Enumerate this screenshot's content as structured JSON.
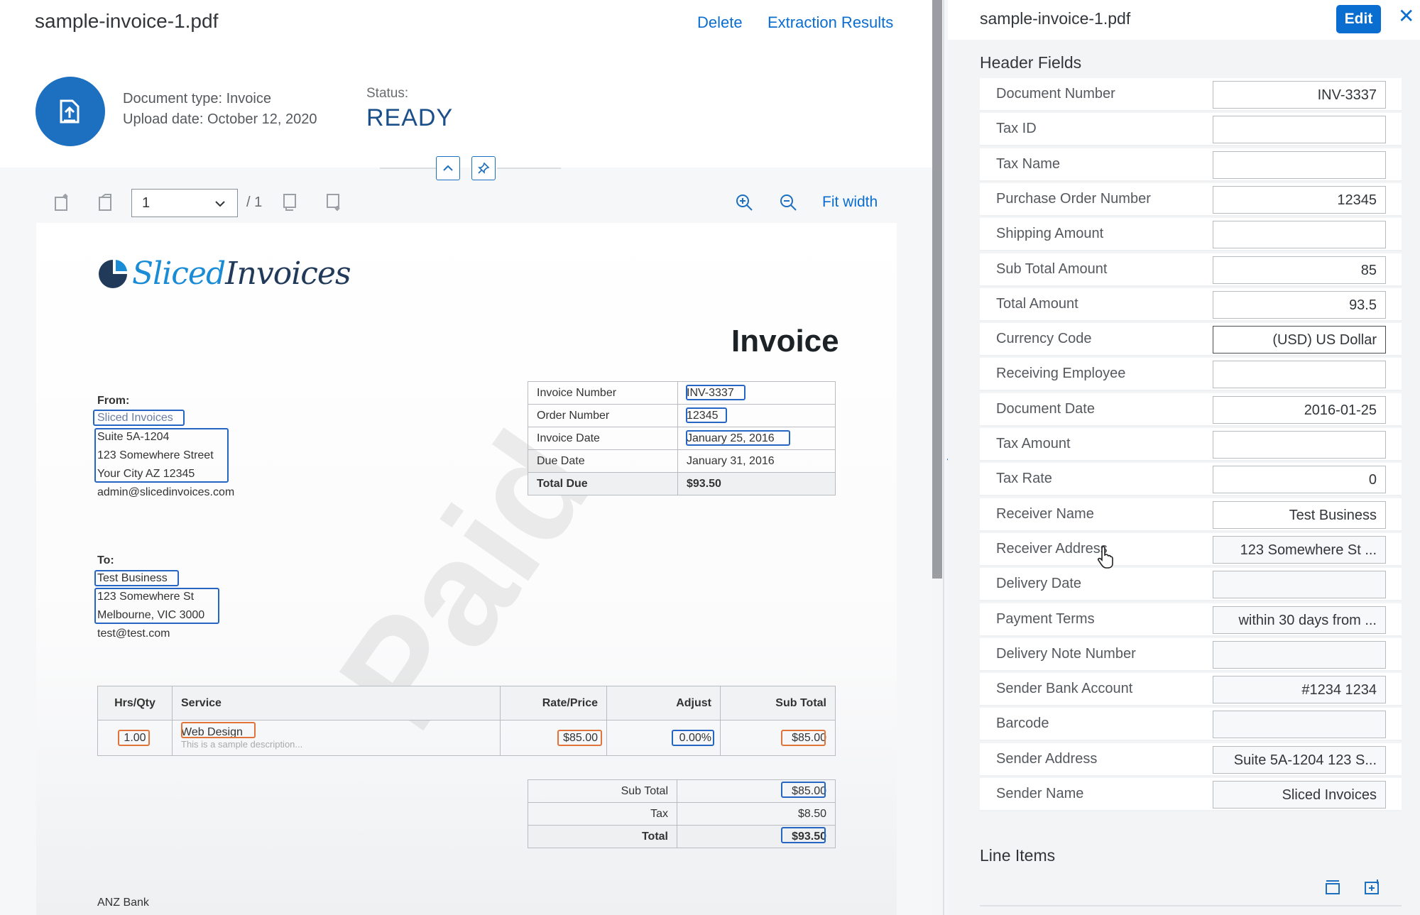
{
  "left_header": {
    "file_name": "sample-invoice-1.pdf",
    "delete_label": "Delete",
    "extraction_results_label": "Extraction Results",
    "document_type": "Document type: Invoice",
    "upload_date": "Upload date: October 12, 2020",
    "status_label": "Status:",
    "status_value": "READY"
  },
  "viewer_toolbar": {
    "page_value": "1",
    "page_total": "/ 1",
    "fit_width_label": "Fit width"
  },
  "invoice": {
    "logo_part1": "Sliced",
    "logo_part2": "Invoices",
    "title": "Invoice",
    "from_label": "From:",
    "from_name": "Sliced Invoices",
    "from_address": [
      "Suite 5A-1204",
      "123 Somewhere Street",
      "Your City AZ 12345"
    ],
    "from_email": "admin@slicedinvoices.com",
    "to_label": "To:",
    "to_name": "Test Business",
    "to_address": [
      "123 Somewhere St",
      "Melbourne, VIC 3000"
    ],
    "to_email": "test@test.com",
    "details": [
      {
        "label": "Invoice Number",
        "value": "INV-3337"
      },
      {
        "label": "Order Number",
        "value": "12345"
      },
      {
        "label": "Invoice Date",
        "value": "January 25, 2016"
      },
      {
        "label": "Due Date",
        "value": "January 31, 2016"
      },
      {
        "label": "Total Due",
        "value": "$93.50"
      }
    ],
    "items_header": {
      "qty": "Hrs/Qty",
      "service": "Service",
      "rate": "Rate/Price",
      "adjust": "Adjust",
      "subtotal": "Sub Total"
    },
    "item": {
      "qty": "1.00",
      "service": "Web Design",
      "description": "This is a sample description...",
      "rate": "$85.00",
      "adjust": "0.00%",
      "subtotal": "$85.00"
    },
    "totals": [
      {
        "label": "Sub Total",
        "value": "$85.00"
      },
      {
        "label": "Tax",
        "value": "$8.50"
      },
      {
        "label": "Total",
        "value": "$93.50"
      }
    ],
    "watermark": "Paid",
    "bank": "ANZ Bank"
  },
  "right_panel": {
    "file_name": "sample-invoice-1.pdf",
    "edit_label": "Edit",
    "close_glyph": "✕",
    "header_fields_title": "Header Fields",
    "line_items_title": "Line Items",
    "fields": [
      {
        "label": "Document Number",
        "value": "INV-3337"
      },
      {
        "label": "Tax ID",
        "value": ""
      },
      {
        "label": "Tax Name",
        "value": ""
      },
      {
        "label": "Purchase Order Number",
        "value": "12345"
      },
      {
        "label": "Shipping Amount",
        "value": ""
      },
      {
        "label": "Sub Total Amount",
        "value": "85"
      },
      {
        "label": "Total Amount",
        "value": "93.5"
      },
      {
        "label": "Currency Code",
        "value": "(USD) US Dollar"
      },
      {
        "label": "Receiving Employee",
        "value": ""
      },
      {
        "label": "Document Date",
        "value": "2016-01-25"
      },
      {
        "label": "Tax Amount",
        "value": ""
      },
      {
        "label": "Tax Rate",
        "value": "0"
      },
      {
        "label": "Receiver Name",
        "value": "Test Business"
      },
      {
        "label": "Receiver Address",
        "value": "123 Somewhere St ..."
      },
      {
        "label": "Delivery Date",
        "value": ""
      },
      {
        "label": "Payment Terms",
        "value": "within 30 days from ..."
      },
      {
        "label": "Delivery Note Number",
        "value": ""
      },
      {
        "label": "Sender Bank Account",
        "value": "#1234 1234"
      },
      {
        "label": "Barcode",
        "value": ""
      },
      {
        "label": "Sender Address",
        "value": "Suite 5A-1204 123 S..."
      },
      {
        "label": "Sender Name",
        "value": "Sliced Invoices"
      }
    ]
  },
  "colors": {
    "accent": "#0a6ed1",
    "highlight_blue": "#2566c4",
    "highlight_orange": "#e0743a"
  }
}
